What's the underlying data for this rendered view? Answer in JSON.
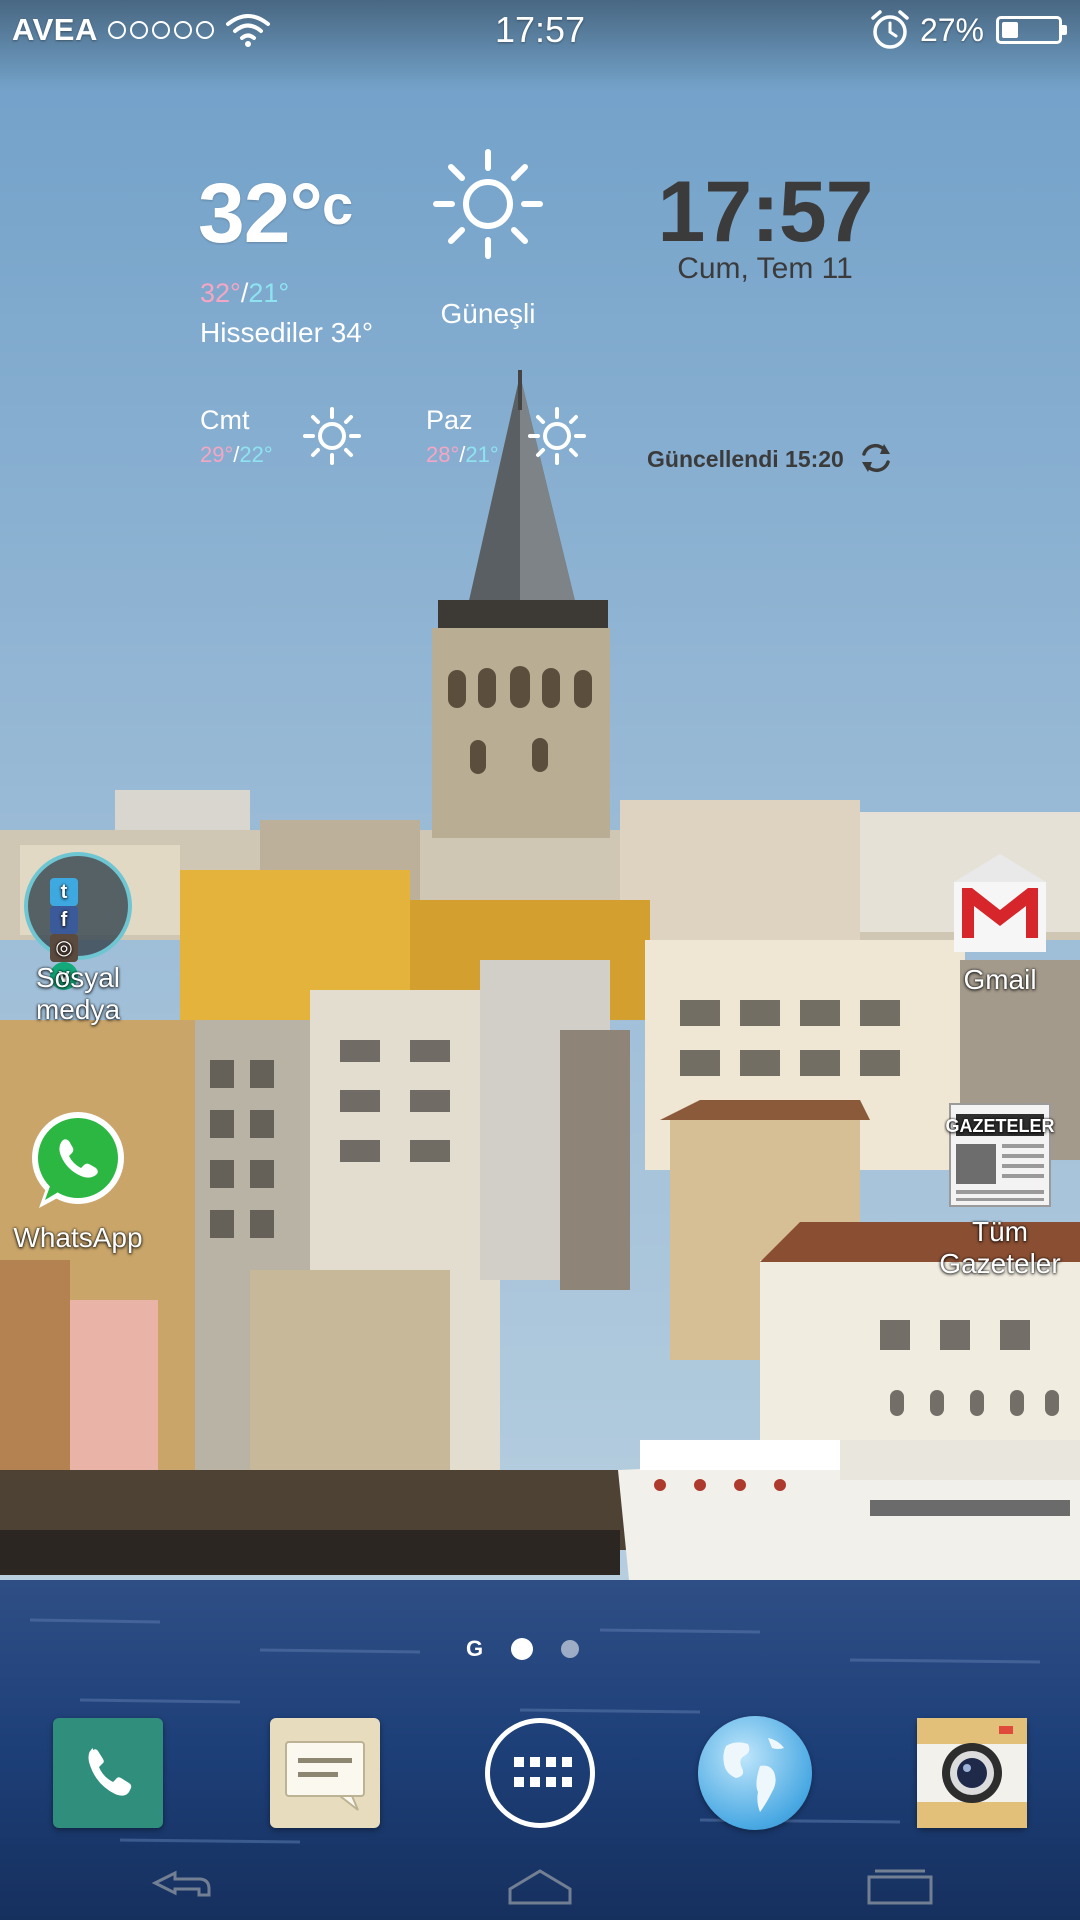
{
  "status_bar": {
    "carrier": "AVEA",
    "time": "17:57",
    "battery_text": "27%",
    "battery_level": 27,
    "icons": [
      "signal-dots-icon",
      "wifi-icon",
      "alarm-clock-icon",
      "battery-icon"
    ]
  },
  "weather_widget": {
    "temp_value": "32°",
    "temp_unit": "c",
    "high": "32°",
    "low": "21°",
    "feels_like": "Hissediler 34°",
    "condition": "Güneşli",
    "clock": "17:57",
    "date": "Cum, Tem 11",
    "forecast": [
      {
        "day": "Cmt",
        "high": "29°",
        "low": "22°"
      },
      {
        "day": "Paz",
        "high": "28°",
        "low": "21°"
      }
    ],
    "updated": "Güncellendi 15:20",
    "colors": {
      "high": "#f5a6c4",
      "low": "#8fe3f0",
      "dark_text": "#3b3b3b"
    }
  },
  "desktop": {
    "apps": [
      {
        "label_line1": "Sosyal",
        "label_line2": "medya",
        "icon": "social-folder-icon"
      },
      {
        "label": "WhatsApp",
        "icon": "whatsapp-icon"
      },
      {
        "label": "Gmail",
        "icon": "gmail-icon"
      },
      {
        "label_line1": "Tüm",
        "label_line2": "Gazeteler",
        "icon": "newspaper-icon"
      }
    ],
    "folder_contents": [
      "twitter-icon",
      "facebook-icon",
      "instagram-icon",
      "vine-icon"
    ]
  },
  "pager": {
    "google_mark": "G",
    "pages": 2,
    "active_page": 1
  },
  "dock": {
    "icons": [
      "phone-icon",
      "messages-icon",
      "app-drawer-icon",
      "browser-icon",
      "camera-icon"
    ]
  },
  "nav": {
    "icons": [
      "back-icon",
      "home-icon",
      "recents-icon"
    ]
  },
  "colors": {
    "sky_top": "#6f9fc8",
    "sky_bottom": "#b6cfe0",
    "water": "#1d3f78",
    "whatsapp_green": "#2bb741",
    "gmail_red": "#d6262c"
  }
}
